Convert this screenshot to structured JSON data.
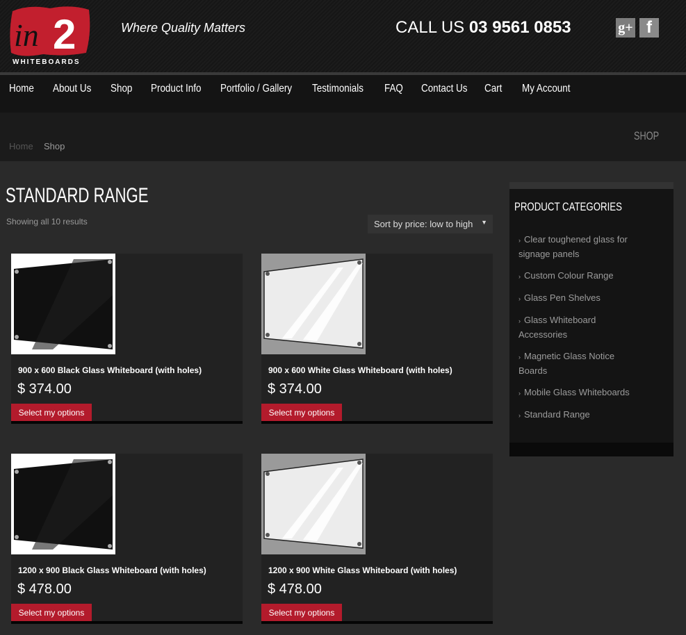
{
  "header": {
    "logo_text": "in2",
    "logo_sub": "WHITEBOARDS",
    "tagline": "Where Quality Matters",
    "call_label": "CALL US",
    "phone": "03 9561 0853",
    "social": [
      {
        "name": "google-plus-icon",
        "glyph": "g+"
      },
      {
        "name": "facebook-icon",
        "glyph": "f"
      }
    ]
  },
  "nav": [
    "Home",
    "About Us",
    "Shop",
    "Product Info",
    "Portfolio / Gallery",
    "Testimonials",
    "FAQ",
    "Contact Us",
    "Cart",
    "My Account"
  ],
  "breadcrumb": {
    "home": "Home",
    "current": "Shop",
    "section_title": "SHOP"
  },
  "main": {
    "title": "STANDARD RANGE",
    "result_count": "Showing all 10 results",
    "sort_selected": "Sort by price: low to high",
    "button_label": "Select my options",
    "products": [
      {
        "name": "900 x 600 Black Glass Whiteboard (with holes)",
        "price": "$ 374.00",
        "variant": "black"
      },
      {
        "name": "900 x 600 White Glass Whiteboard (with holes)",
        "price": "$ 374.00",
        "variant": "white"
      },
      {
        "name": "1200 x 900 Black Glass Whiteboard (with holes)",
        "price": "$ 478.00",
        "variant": "black"
      },
      {
        "name": "1200 x 900 White Glass Whiteboard (with holes)",
        "price": "$ 478.00",
        "variant": "white"
      }
    ]
  },
  "sidebar": {
    "title": "PRODUCT CATEGORIES",
    "categories": [
      "Clear toughened glass for signage panels",
      "Custom Colour Range",
      "Glass Pen Shelves",
      "Glass Whiteboard Accessories",
      "Magnetic Glass Notice Boards",
      "Mobile Glass Whiteboards",
      "Standard Range"
    ]
  },
  "colors": {
    "accent": "#b31b2c",
    "background": "#2a2a2a",
    "nav": "#141414"
  }
}
